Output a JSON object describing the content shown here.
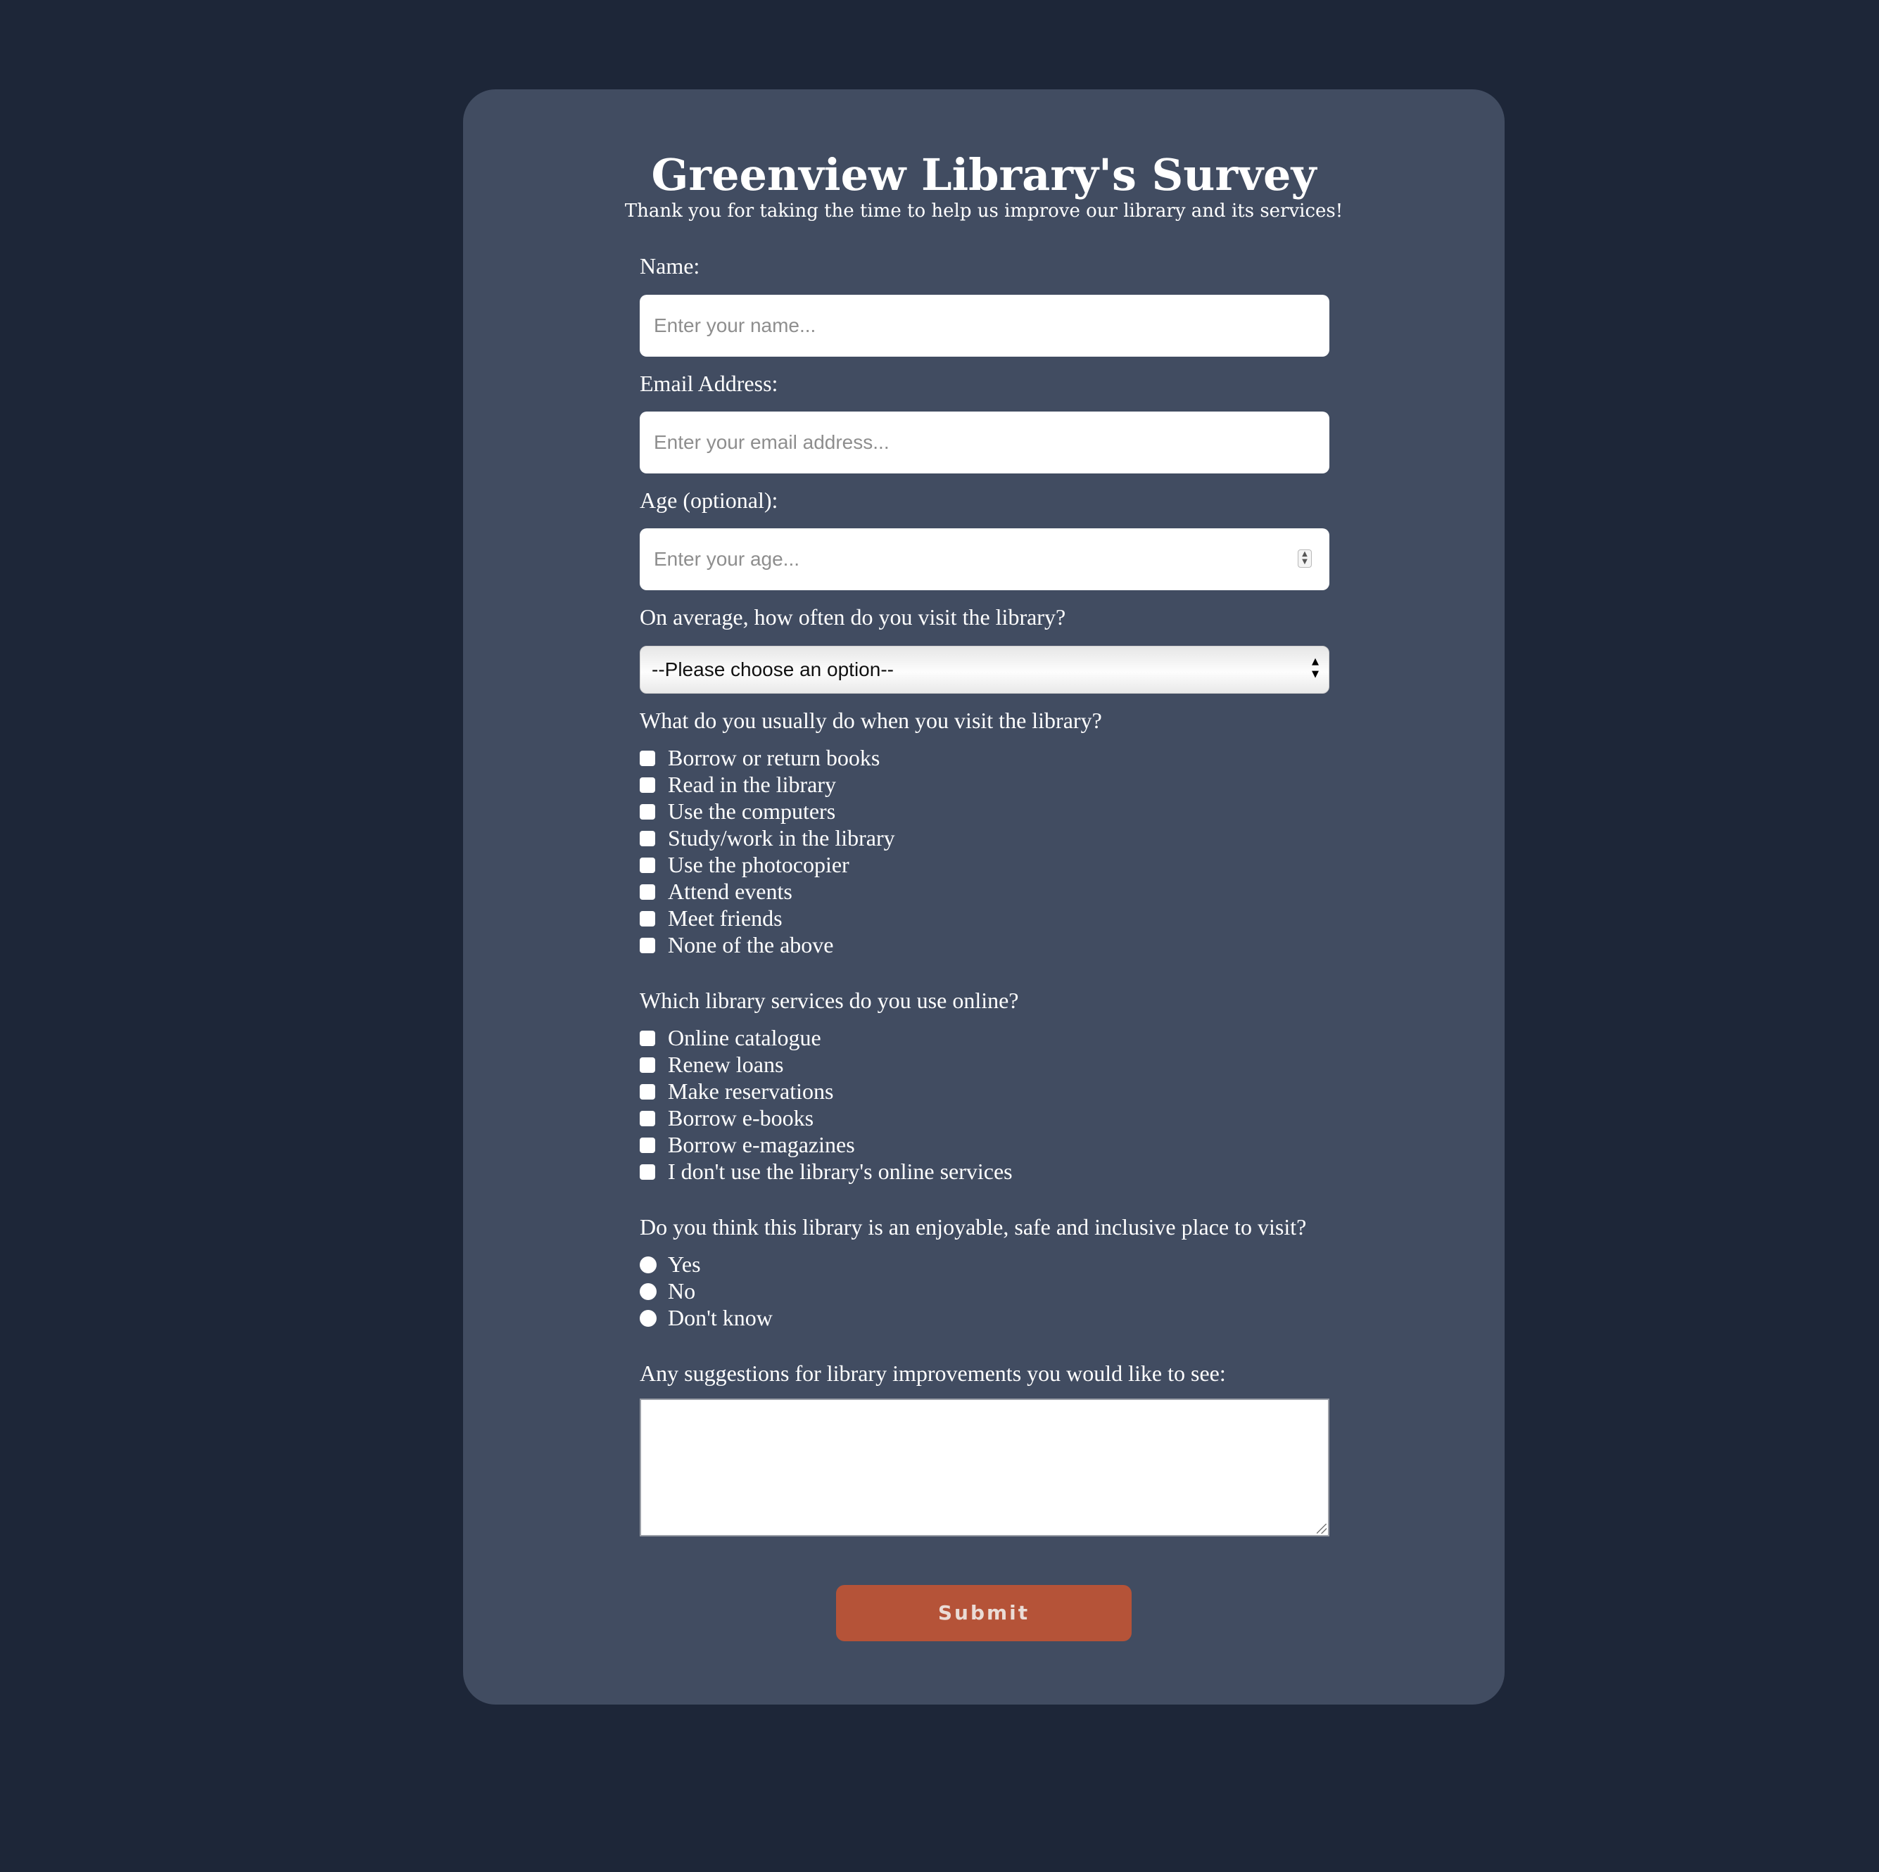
{
  "header": {
    "title": "Greenview Library's Survey",
    "subtitle": "Thank you for taking the time to help us improve our library and its services!"
  },
  "fields": {
    "name": {
      "label": "Name:",
      "placeholder": "Enter your name...",
      "value": ""
    },
    "email": {
      "label": "Email Address:",
      "placeholder": "Enter your email address...",
      "value": ""
    },
    "age": {
      "label": "Age (optional):",
      "placeholder": "Enter your age...",
      "value": ""
    }
  },
  "visit_frequency": {
    "label": "On average, how often do you visit the library?",
    "selected": "--Please choose an option--"
  },
  "activities": {
    "label": "What do you usually do when you visit the library?",
    "options": [
      "Borrow or return books",
      "Read in the library",
      "Use the computers",
      "Study/work in the library",
      "Use the photocopier",
      "Attend events",
      "Meet friends",
      "None of the above"
    ]
  },
  "online_services": {
    "label": "Which library services do you use online?",
    "options": [
      "Online catalogue",
      "Renew loans",
      "Make reservations",
      "Borrow e-books",
      "Borrow e-magazines",
      "I don't use the library's online services"
    ]
  },
  "inclusive": {
    "label": "Do you think this library is an enjoyable, safe and inclusive place to visit?",
    "options": [
      "Yes",
      "No",
      "Don't know"
    ]
  },
  "suggestions": {
    "label": "Any suggestions for library improvements you would like to see:",
    "value": ""
  },
  "submit_label": "Submit",
  "colors": {
    "page_background": "#1d2638",
    "card_background": "#414c61",
    "submit_button": "#b55338"
  }
}
